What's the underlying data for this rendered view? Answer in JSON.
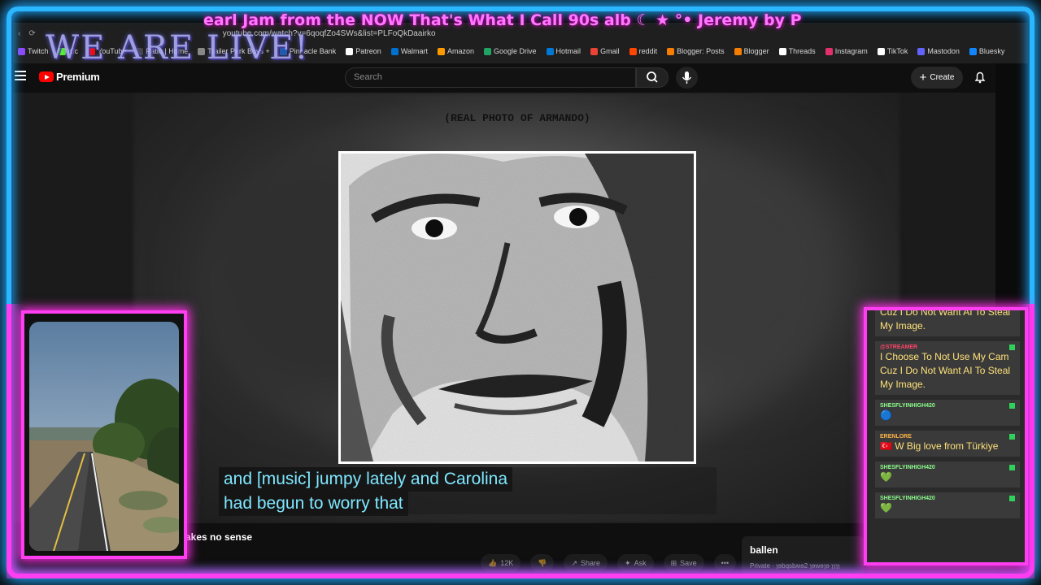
{
  "overlay": {
    "ticker": "earl Jam from the NOW That's What I Call 90s alb ☾ ★ °• Jeremy by P",
    "live_text": "WE ARE LIVE!"
  },
  "browser": {
    "url": "youtube.com/watch?v=6qoqfZo4SWs&list=PLFoQkDaairko",
    "bookmarks": [
      {
        "label": "Twitch",
        "color": "#9146ff"
      },
      {
        "label": "Kic",
        "color": "#53fc18"
      },
      {
        "label": "YouTube",
        "color": "#ff0000"
      },
      {
        "label": "Patio | Home",
        "color": "#444444"
      },
      {
        "label": "Trailer Park Boys +",
        "color": "#888888"
      },
      {
        "label": "Pinnacle Bank",
        "color": "#1a5aa8"
      },
      {
        "label": "Patreon",
        "color": "#ffffff"
      },
      {
        "label": "Walmart",
        "color": "#0071ce"
      },
      {
        "label": "Amazon",
        "color": "#ff9900"
      },
      {
        "label": "Google Drive",
        "color": "#1fa463"
      },
      {
        "label": "Hotmail",
        "color": "#0078d4"
      },
      {
        "label": "Gmail",
        "color": "#ea4335"
      },
      {
        "label": "reddit",
        "color": "#ff4500"
      },
      {
        "label": "Blogger: Posts",
        "color": "#f57d00"
      },
      {
        "label": "Blogger",
        "color": "#f57d00"
      },
      {
        "label": "Threads",
        "color": "#ffffff"
      },
      {
        "label": "Instagram",
        "color": "#e1306c"
      },
      {
        "label": "TikTok",
        "color": "#ffffff"
      },
      {
        "label": "Mastodon",
        "color": "#6364ff"
      },
      {
        "label": "Bluesky",
        "color": "#1185fe"
      }
    ]
  },
  "youtube": {
    "brand": "Premium",
    "search_placeholder": "Search",
    "create_label": "Create"
  },
  "video": {
    "photo_title": "(REAL PHOTO OF ARMANDO)",
    "caption_line1": "and [music] jumpy lately and Carolina",
    "caption_line2": "had begun to worry that"
  },
  "below": {
    "title": "akes no sense",
    "like_count": "12K",
    "share_label": "Share",
    "ask_label": "Ask",
    "save_label": "Save",
    "side_title": "ballen",
    "side_sub": "Private · ɿɘbqsbʍɘ2 ɿɘwɘɿɘ ɿɿɿɿ"
  },
  "chat": {
    "messages": [
      {
        "user": "",
        "user_color": "#ff4466",
        "text": "Cuz I Do Not Want AI To Steal My Image."
      },
      {
        "user": "@STREAMER",
        "user_color": "#ff4466",
        "text": "I Choose To Not Use My Cam Cuz I Do Not Want AI To Steal My Image."
      },
      {
        "user": "SHESFLYINHIGH420",
        "user_color": "#8cff8c",
        "text": "🔵"
      },
      {
        "user": "ERENLORE",
        "user_color": "#ffb347",
        "text": "🇹🇷 W Big love from Türkiye"
      },
      {
        "user": "SHESFLYINHIGH420",
        "user_color": "#8cff8c",
        "text": "💚"
      },
      {
        "user": "SHESFLYINHIGH420",
        "user_color": "#8cff8c",
        "text": "💚"
      }
    ]
  }
}
